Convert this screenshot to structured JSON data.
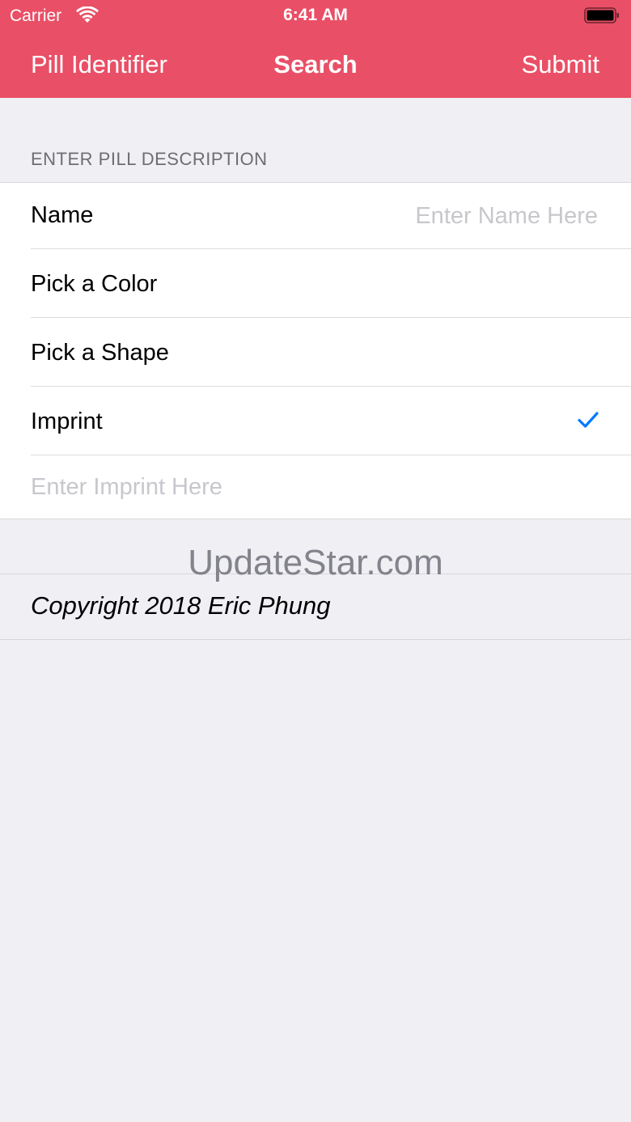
{
  "status_bar": {
    "carrier": "Carrier",
    "time": "6:41 AM",
    "wifi_icon": "wifi-icon",
    "battery_icon": "battery-icon"
  },
  "nav": {
    "back_label": "Pill Identifier",
    "title": "Search",
    "submit_label": "Submit"
  },
  "section": {
    "header": "ENTER PILL DESCRIPTION"
  },
  "form": {
    "name_label": "Name",
    "name_placeholder": "Enter Name Here",
    "color_label": "Pick a Color",
    "shape_label": "Pick a Shape",
    "imprint_label": "Imprint",
    "imprint_checked": true,
    "imprint_placeholder": "Enter Imprint Here"
  },
  "watermark": "UpdateStar.com",
  "footer": {
    "copyright": "Copyright 2018 Eric Phung"
  },
  "colors": {
    "nav_background": "#e94f66",
    "accent": "#007aff",
    "page_background": "#efeff4"
  }
}
